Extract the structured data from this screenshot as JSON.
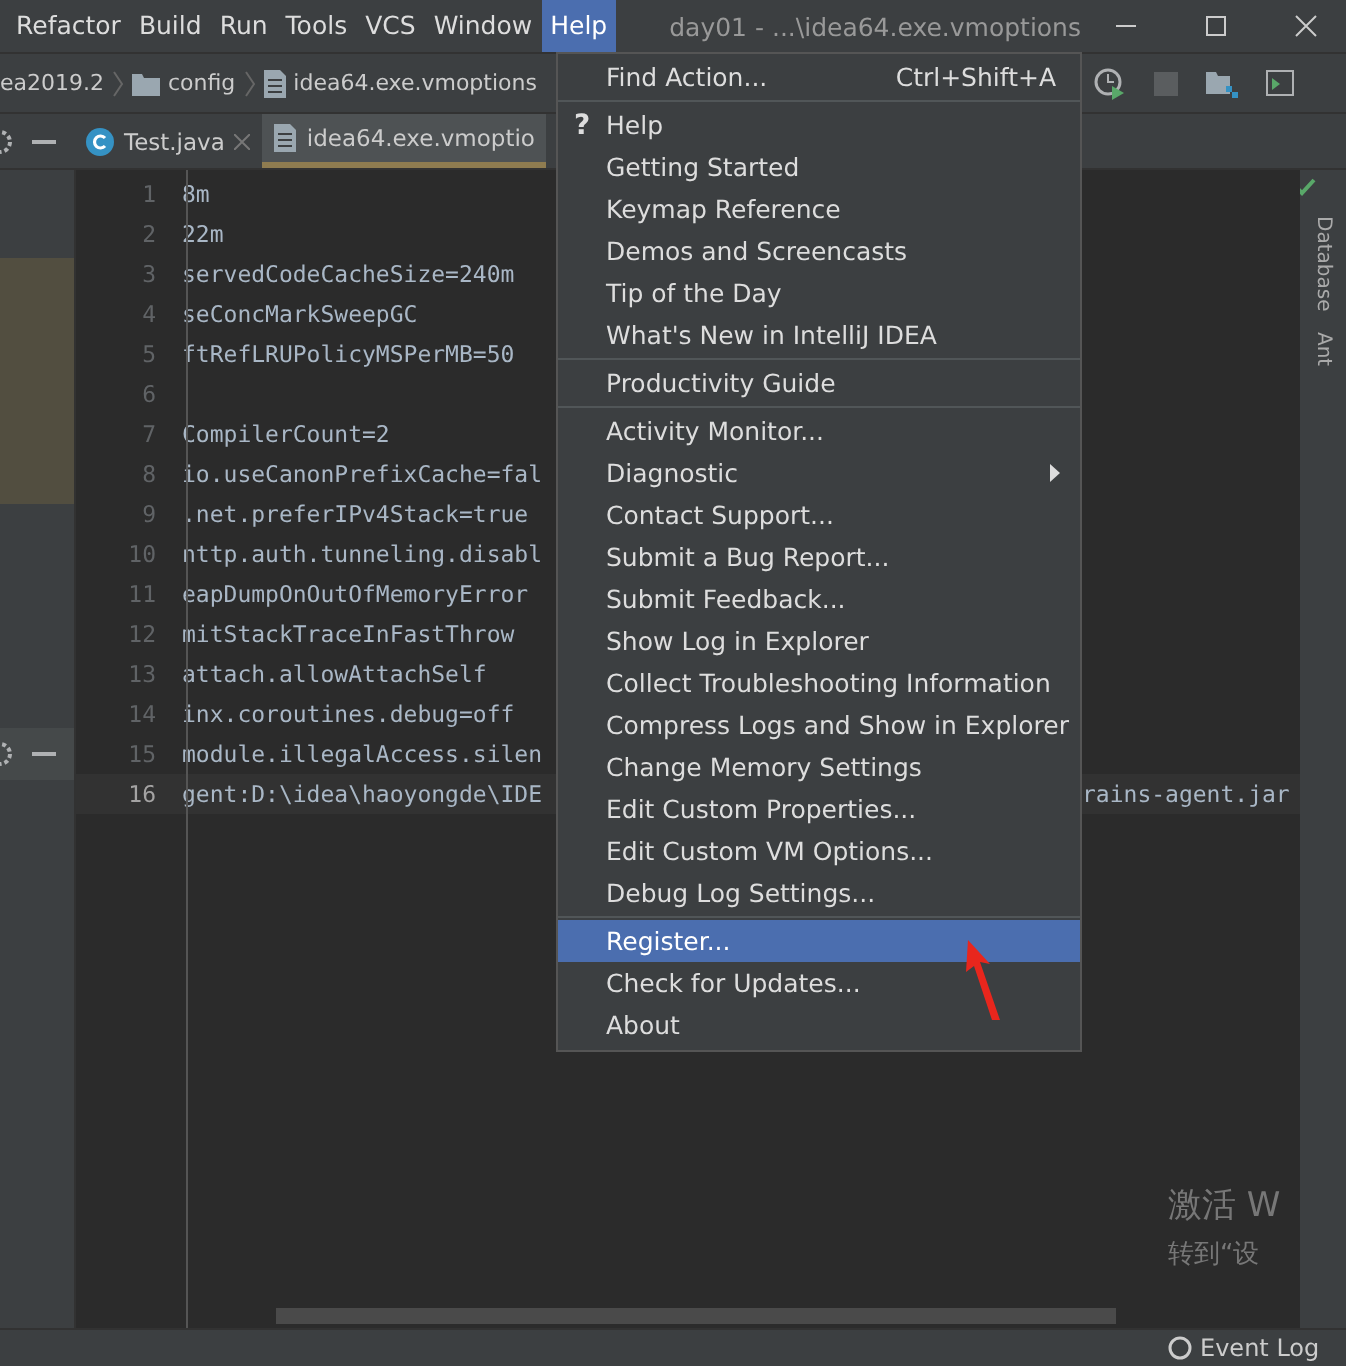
{
  "menu_bar": {
    "items": [
      {
        "label": "Refactor",
        "selected": false
      },
      {
        "label": "Build",
        "selected": false
      },
      {
        "label": "Run",
        "selected": false
      },
      {
        "label": "Tools",
        "selected": false
      },
      {
        "label": "VCS",
        "selected": false
      },
      {
        "label": "Window",
        "selected": false
      },
      {
        "label": "Help",
        "selected": true
      }
    ],
    "title": "day01 - ...\\idea64.exe.vmoptions"
  },
  "breadcrumb": [
    {
      "label": "ea2019.2",
      "kind": "project"
    },
    {
      "label": "config",
      "kind": "folder"
    },
    {
      "label": "idea64.exe.vmoptions",
      "kind": "file"
    }
  ],
  "tabs": [
    {
      "label": "Test.java",
      "kind": "java",
      "selected": false
    },
    {
      "label": "idea64.exe.vmoptio",
      "kind": "file",
      "selected": true
    }
  ],
  "editor": {
    "lines": [
      {
        "number": "1",
        "text": "8m",
        "current": false
      },
      {
        "number": "2",
        "text": "22m",
        "current": false
      },
      {
        "number": "3",
        "text": "servedCodeCacheSize=240m",
        "current": false
      },
      {
        "number": "4",
        "text": "seConcMarkSweepGC",
        "current": false
      },
      {
        "number": "5",
        "text": "ftRefLRUPolicyMSPerMB=50",
        "current": false
      },
      {
        "number": "6",
        "current": false
      },
      {
        "number": "7",
        "text": "CompilerCount=2",
        "current": false
      },
      {
        "number": "8",
        "text": "io.useCanonPrefixCache=fal",
        "current": false
      },
      {
        "number": "9",
        "text": ".net.preferIPv4Stack=true",
        "current": false
      },
      {
        "number": "10",
        "text": "nttp.auth.tunneling.disabl",
        "current": false
      },
      {
        "number": "11",
        "text": "eapDumpOnOutOfMemoryError",
        "current": false
      },
      {
        "number": "12",
        "text": "mitStackTraceInFastThrow",
        "current": false
      },
      {
        "number": "13",
        "text": "attach.allowAttachSelf",
        "current": false
      },
      {
        "number": "14",
        "text": "inx.coroutines.debug=off",
        "current": false
      },
      {
        "number": "15",
        "text": "module.illegalAccess.silen",
        "current": false
      },
      {
        "number": "16",
        "text": "gent:D:\\idea\\haoyongde\\IDE",
        "tail": "rains-agent.jar",
        "current": true
      }
    ]
  },
  "help_menu": {
    "groups": [
      [
        {
          "label": "Find Action...",
          "shortcut": "Ctrl+Shift+A",
          "selected": false
        }
      ],
      [
        {
          "label": "Help",
          "icon": "?",
          "selected": false
        },
        {
          "label": "Getting Started",
          "selected": false
        },
        {
          "label": "Keymap Reference",
          "selected": false
        },
        {
          "label": "Demos and Screencasts",
          "selected": false
        },
        {
          "label": "Tip of the Day",
          "selected": false
        },
        {
          "label": "What's New in IntelliJ IDEA",
          "selected": false
        }
      ],
      [
        {
          "label": "Productivity Guide",
          "selected": false
        }
      ],
      [
        {
          "label": "Activity Monitor...",
          "selected": false
        },
        {
          "label": "Diagnostic",
          "submenu": true,
          "selected": false
        },
        {
          "label": "Contact Support...",
          "selected": false
        },
        {
          "label": "Submit a Bug Report...",
          "selected": false
        },
        {
          "label": "Submit Feedback...",
          "selected": false
        },
        {
          "label": "Show Log in Explorer",
          "selected": false
        },
        {
          "label": "Collect Troubleshooting Information",
          "selected": false
        },
        {
          "label": "Compress Logs and Show in Explorer",
          "selected": false
        },
        {
          "label": "Change Memory Settings",
          "selected": false
        },
        {
          "label": "Edit Custom Properties...",
          "selected": false
        },
        {
          "label": "Edit Custom VM Options...",
          "selected": false
        },
        {
          "label": "Debug Log Settings...",
          "selected": false
        }
      ],
      [
        {
          "label": "Register...",
          "selected": true
        },
        {
          "label": "Check for Updates...",
          "selected": false
        },
        {
          "label": "About",
          "selected": false
        }
      ]
    ]
  },
  "side_tabs": [
    "Database",
    "Ant"
  ],
  "activation_notice": [
    "激活 W",
    "转到“设"
  ],
  "status_bar": {
    "event_log": "Event Log"
  }
}
